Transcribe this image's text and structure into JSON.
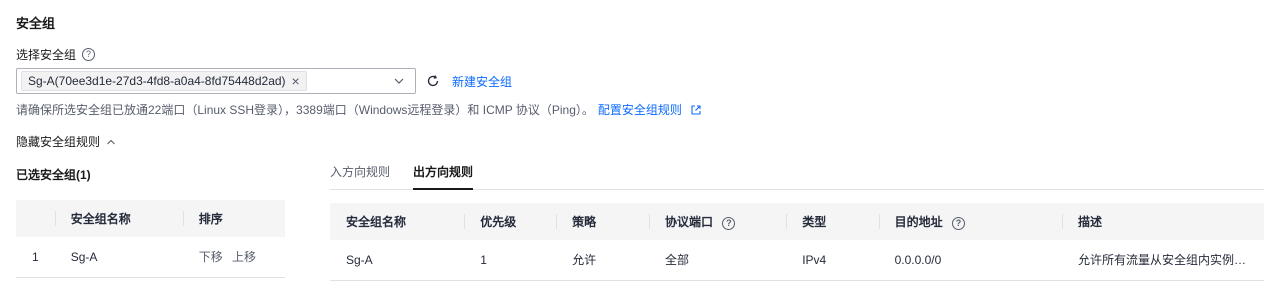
{
  "section_title": "安全组",
  "select_label": "选择安全组",
  "selected_tag": "Sg-A(70ee3d1e-27d3-4fd8-a0a4-8fd75448d2ad)",
  "create_link": "新建安全组",
  "hint": {
    "text": "请确保所选安全组已放通22端口（Linux SSH登录），3389端口（Windows远程登录）和 ICMP 协议（Ping）。",
    "link": "配置安全组规则"
  },
  "toggle_label": "隐藏安全组规则",
  "selected_groups_title": "已选安全组(1)",
  "left_table": {
    "headers": [
      "",
      "安全组名称",
      "排序"
    ],
    "rows": [
      {
        "index": "1",
        "name": "Sg-A",
        "move_down": "下移",
        "move_up": "上移"
      }
    ]
  },
  "tabs": [
    {
      "label": "入方向规则",
      "active": false
    },
    {
      "label": "出方向规则",
      "active": true
    }
  ],
  "rules_table": {
    "headers": [
      "安全组名称",
      "优先级",
      "策略",
      "协议端口",
      "类型",
      "目的地址",
      "描述"
    ],
    "rows": [
      {
        "name": "Sg-A",
        "priority": "1",
        "policy": "允许",
        "port": "全部",
        "type": "IPv4",
        "dest": "0.0.0.0/0",
        "desc": "允许所有流量从安全组内实例流..."
      }
    ]
  },
  "colors": {
    "link": "#0d6bff",
    "header_bg": "#f5f5f6",
    "border": "#dfe1e6"
  }
}
